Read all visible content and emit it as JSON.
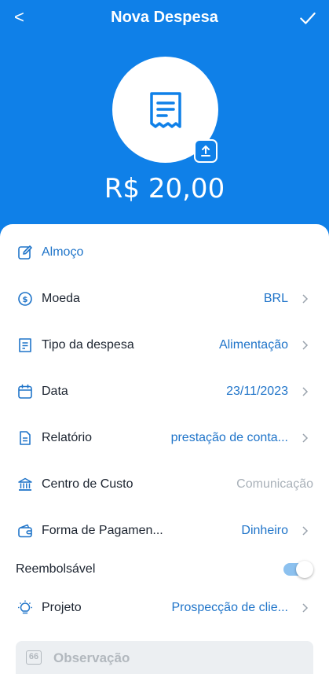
{
  "header": {
    "back_glyph": "<",
    "title": "Nova Despesa",
    "confirm_icon": "check-icon",
    "amount": "R$ 20,00"
  },
  "description": "Almoço",
  "fields": [
    {
      "label": "Moeda",
      "value": "BRL",
      "icon": "dollar-circle-icon"
    },
    {
      "label": "Tipo da despesa",
      "value": "Alimentação",
      "icon": "receipt-icon"
    },
    {
      "label": "Data",
      "value": "23/11/2023",
      "icon": "calendar-icon"
    },
    {
      "label": "Relatório",
      "value": "prestação de conta...",
      "icon": "document-icon"
    },
    {
      "label": "Centro de Custo",
      "value": "Comunicação",
      "icon": "bank-icon"
    },
    {
      "label": "Forma de Pagamen...",
      "value": "Dinheiro",
      "icon": "wallet-icon"
    }
  ],
  "reimbursable": {
    "label": "Reembolsável",
    "enabled": true
  },
  "project": {
    "label": "Projeto",
    "value": "Prospecção de clie...",
    "icon": "lightbulb-icon"
  },
  "observation": {
    "label": "Observação",
    "badge": "66"
  },
  "colors": {
    "primary": "#0f80e8",
    "link": "#1f74c9",
    "muted": "#a8b0b8"
  }
}
